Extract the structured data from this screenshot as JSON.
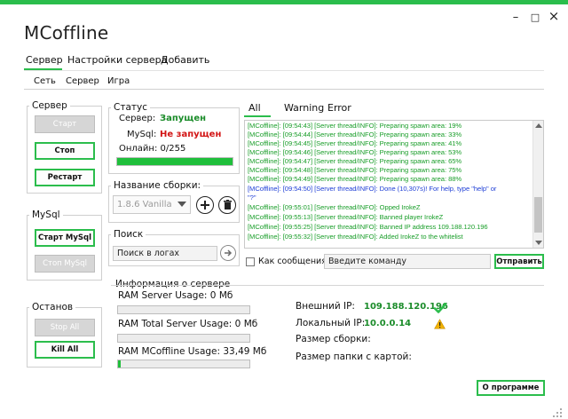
{
  "window": {
    "title": "MCoffline",
    "minimize_glyph": "–",
    "restore_glyph": "□",
    "close_glyph": "×",
    "accent_color": "#2bbd4c"
  },
  "main_tabs": [
    {
      "label": "Сервер",
      "active": true
    },
    {
      "label": "Настройки сервера",
      "active": false
    },
    {
      "label": "Добавить",
      "active": false
    }
  ],
  "sub_tabs": [
    {
      "label": "Сеть"
    },
    {
      "label": "Сервер"
    },
    {
      "label": "Игра"
    }
  ],
  "server_group": {
    "title": "Сервер",
    "start_label": "Старт",
    "stop_label": "Стоп",
    "restart_label": "Рестарт"
  },
  "mysql_group": {
    "title": "MySql",
    "start_label": "Старт MySql",
    "stop_label": "Стоп MySql"
  },
  "halt_group": {
    "title": "Останов",
    "stop_all_label": "Stop All",
    "kill_all_label": "Kill All"
  },
  "status_group": {
    "title": "Статус",
    "server_label": "Сервер:",
    "server_value": "Запущен",
    "mysql_label": "MySql:",
    "mysql_value": "Не запущен",
    "online_label": "Онлайн: 0/255",
    "online_progress": 1.0
  },
  "build_group": {
    "title": "Название сборки:",
    "selected": "1.8.6 Vanilla",
    "add_icon": "plus-circle-icon",
    "delete_icon": "trash-icon"
  },
  "search_group": {
    "title": "Поиск",
    "value": "Поиск в логах",
    "go_icon": "arrow-right-circle-icon"
  },
  "log_tabs": [
    {
      "label": "All",
      "active": true
    },
    {
      "label": "Warning",
      "active": false
    },
    {
      "label": "Error",
      "active": false
    }
  ],
  "log_lines": [
    {
      "text": "[MCoffline]: [09:54:43] [Server thread/INFO]: Preparing spawn area: 19%",
      "color": "g"
    },
    {
      "text": "[MCoffline]: [09:54:44] [Server thread/INFO]: Preparing spawn area: 33%",
      "color": "g"
    },
    {
      "text": "[MCoffline]: [09:54:45] [Server thread/INFO]: Preparing spawn area: 41%",
      "color": "g"
    },
    {
      "text": "[MCoffline]: [09:54:46] [Server thread/INFO]: Preparing spawn area: 53%",
      "color": "g"
    },
    {
      "text": "[MCoffline]: [09:54:47] [Server thread/INFO]: Preparing spawn area: 65%",
      "color": "g"
    },
    {
      "text": "[MCoffline]: [09:54:48] [Server thread/INFO]: Preparing spawn area: 75%",
      "color": "g"
    },
    {
      "text": "[MCoffline]: [09:54:49] [Server thread/INFO]: Preparing spawn area: 88%",
      "color": "g"
    },
    {
      "text": "[MCoffline]: [09:54:50] [Server thread/INFO]: Done (10,307s)! For help, type \"help\" or",
      "color": "b"
    },
    {
      "text": "\"?\"",
      "color": "b"
    },
    {
      "text": "[MCoffline]: [09:55:01] [Server thread/INFO]: Opped IrokeZ",
      "color": "g"
    },
    {
      "text": "[MCoffline]: [09:55:13] [Server thread/INFO]: Banned player IrokeZ",
      "color": "g"
    },
    {
      "text": "[MCoffline]: [09:55:25] [Server thread/INFO]: Banned IP address 109.188.120.196",
      "color": "g"
    },
    {
      "text": "[MCoffline]: [09:55:32] [Server thread/INFO]: Added IrokeZ to the whitelist",
      "color": "g"
    }
  ],
  "command": {
    "checkbox_label": "Как сообщения:",
    "checked": false,
    "value": "Введите команду",
    "send_label": "Отправить"
  },
  "server_info": {
    "title": "Информация о сервере",
    "ram_server_label": "RAM Server Usage: 0 Мб",
    "ram_server_progress": 0.0,
    "ram_total_label": "RAM Total Server Usage: 0 Мб",
    "ram_total_progress": 0.0,
    "ram_mcoffline_label": "RAM MCoffline Usage: 33,49 Мб",
    "ram_mcoffline_progress": 0.02,
    "external_ip_label": "Внешний IP:",
    "external_ip_value": "109.188.120.196",
    "external_ip_icon": "check-icon",
    "local_ip_label": "Локальный IP:",
    "local_ip_value": "10.0.0.14",
    "local_ip_icon": "warning-icon",
    "build_size_label": "Размер сборки:",
    "map_size_label": "Размер папки с картой:"
  },
  "about_label": "О программе"
}
